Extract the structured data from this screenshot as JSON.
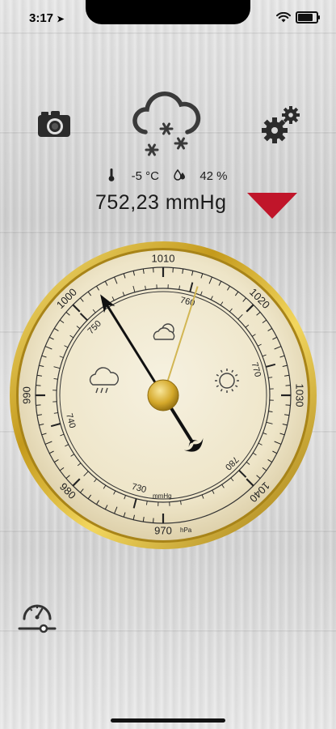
{
  "status_bar": {
    "time": "3:17",
    "location_arrow": "location-arrow-icon"
  },
  "toolbar": {
    "camera_icon": "camera-icon",
    "settings_icon": "gears-icon",
    "weather_icon": "snow-cloud-icon"
  },
  "readout": {
    "temperature": "-5 °C",
    "humidity": "42 %",
    "pressure": "752,23 mmHg",
    "trend_color": "#c0152a",
    "trend": "falling"
  },
  "gauge": {
    "hpa_labels": [
      "970",
      "980",
      "990",
      "1000",
      "1010",
      "1020",
      "1030",
      "1040"
    ],
    "mmhg_labels": [
      "730",
      "740",
      "750",
      "760",
      "770",
      "780"
    ],
    "hpa_unit": "hPa",
    "mmhg_unit": "mmHg",
    "needle_value_mmhg": 752.23,
    "reference_value_mmhg": 760.5,
    "colors": {
      "bezel": "#c9a227",
      "dial": "#efe7cf",
      "needle": "#111111",
      "hub": "#d4a82a"
    }
  },
  "bottom": {
    "calibrate_icon": "gauge-calibrate-icon"
  }
}
